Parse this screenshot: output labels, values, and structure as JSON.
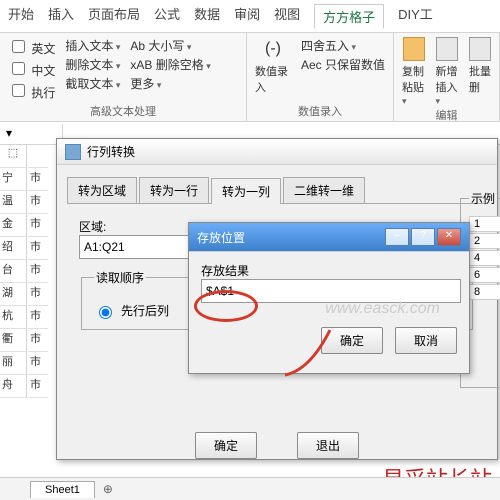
{
  "ribbon_tabs": [
    "开始",
    "插入",
    "页面布局",
    "公式",
    "数据",
    "审阅",
    "视图",
    "方方格子",
    "DIY工"
  ],
  "ribbon_active": 7,
  "groups": {
    "g1": {
      "items": [
        "英文",
        "中文",
        "执行"
      ],
      "ops": [
        "插入文本",
        "删除文本",
        "截取文本"
      ],
      "extras": [
        "Ab 大小写",
        "xAB 删除空格",
        "更多"
      ],
      "label": "高级文本处理"
    },
    "g2": {
      "big": "数值录入",
      "items": [
        "四舍五入",
        "Aec 只保留数值"
      ],
      "label": "数值录入"
    },
    "g3": {
      "items": [
        "复制粘贴",
        "新增插入",
        "批量删"
      ],
      "label": "编辑"
    }
  },
  "colA": [
    "宁",
    "温",
    "金",
    "绍",
    "台",
    "湖",
    "杭",
    "衢",
    "丽",
    "舟"
  ],
  "lineB": "市",
  "dlg1": {
    "title": "行列转换",
    "tabs": [
      "转为区域",
      "转为一行",
      "转为一列",
      "二维转一维"
    ],
    "active": 2,
    "region_label": "区域:",
    "region_val": "A1:Q21",
    "order_legend": "读取顺序",
    "radio": "先行后列",
    "ok": "确定",
    "exit": "退出",
    "example": "示例",
    "exlist": [
      "1",
      "2",
      "4",
      "6",
      "8"
    ]
  },
  "dlg2": {
    "title": "存放位置",
    "result_label": "存放结果",
    "result_val": "$A$1",
    "ok": "确定",
    "cancel": "取消"
  },
  "sheet": "Sheet1",
  "wm1": "www.easck.com",
  "wm2": "易采站长站"
}
